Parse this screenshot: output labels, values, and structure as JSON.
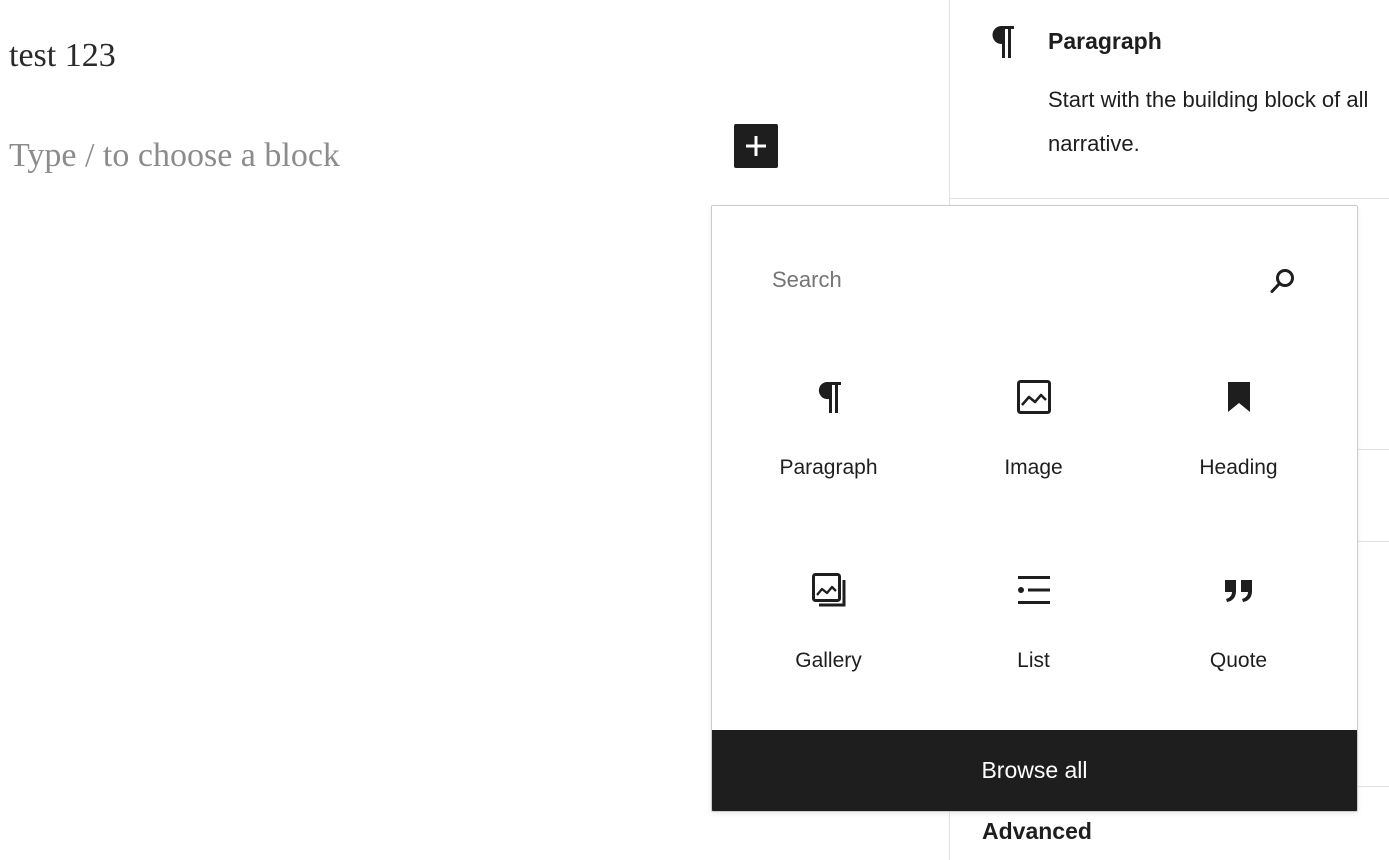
{
  "editor": {
    "post_title": "test 123",
    "block_placeholder": "Type / to choose a block"
  },
  "inserter_toggle": {
    "icon": "plus-icon"
  },
  "sidebar": {
    "block_card": {
      "icon": "paragraph-icon",
      "title": "Paragraph",
      "description": "Start with the building block of all narrative."
    },
    "advanced_label": "Advanced"
  },
  "quick_inserter": {
    "search": {
      "placeholder": "Search",
      "value": "",
      "icon": "search-icon"
    },
    "blocks": [
      {
        "label": "Paragraph",
        "icon": "paragraph-icon"
      },
      {
        "label": "Image",
        "icon": "image-icon"
      },
      {
        "label": "Heading",
        "icon": "bookmark-icon"
      },
      {
        "label": "Gallery",
        "icon": "gallery-icon"
      },
      {
        "label": "List",
        "icon": "list-icon"
      },
      {
        "label": "Quote",
        "icon": "quote-icon"
      }
    ],
    "browse_all_label": "Browse all"
  }
}
